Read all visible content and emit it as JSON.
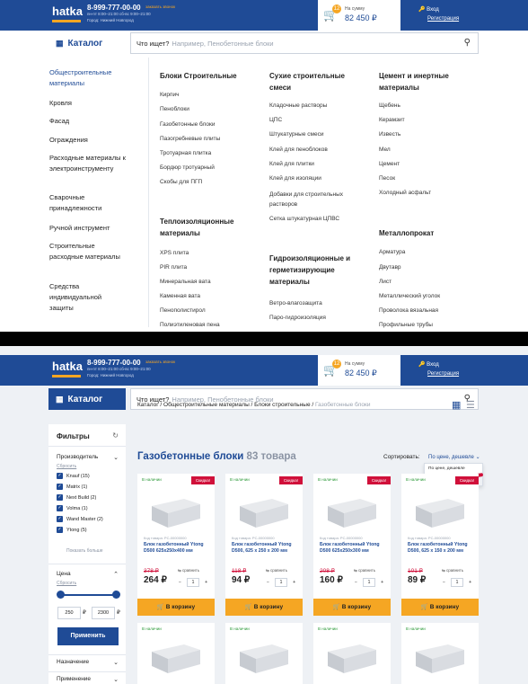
{
  "header": {
    "logo_text": "hatka",
    "phone": "8-999-777-00-00",
    "callback": "заказать звонок",
    "hours": "пн-пт 8:00–21:00  сб-вс 9:00–21:00",
    "city": "Город: Нижний Новгород",
    "cart_badge": "12",
    "cart_label": "На сумму",
    "cart_sum": "82 450 ₽",
    "login": "Вход",
    "register": "Регистрация"
  },
  "search": {
    "catalog_label": "Каталог",
    "prompt": "Что ищет?",
    "placeholder": "Например, Пенобетонные блоки"
  },
  "menu": {
    "left": [
      "Общестроительные материалы",
      "Кровля",
      "Фасад",
      "Ограждения",
      "Расходные материалы к электроинструменту",
      "Сварочные принадлежности",
      "Ручной инструмент",
      "Строительные расходные материалы",
      "Средства индивидуальной защиты"
    ],
    "columns": [
      {
        "groups": [
          {
            "title": "Блоки Строительные",
            "items": [
              "Кирпич",
              "Пеноблоки",
              "Газобетонные блоки",
              "Пазогребневые плиты",
              "Тротуарная плитка",
              "Бордюр тротуарный",
              "Скобы для ПГП"
            ]
          },
          {
            "title": "Теплоизоляционные материалы",
            "items": [
              "XPS плита",
              "PIR плита",
              "Минеральная вата",
              "Каменная вата",
              "Пенополистирол",
              "Полиэтиленовая пена"
            ]
          }
        ]
      },
      {
        "groups": [
          {
            "title": "Сухие строительные смеси",
            "items": [
              "Кладочные растворы",
              "ЦПС",
              "Штукатурные смеси",
              "Клей для пеноблоков",
              "Клей для плитки",
              "Клей для изоляции",
              "Добавки для строительных растворов",
              "Сетка штукатурная ЦПВС"
            ]
          },
          {
            "title": "Гидроизоляционные и герметизирующие материалы",
            "items": [
              "Ветро-влагозащита",
              "Паро-гидроизоляция"
            ]
          }
        ]
      },
      {
        "groups": [
          {
            "title": "Цемент и инертные материалы",
            "items": [
              "Щебень",
              "Керамзит",
              "Известь",
              "Мел",
              "Цемент",
              "Песок",
              "Холодный асфальт"
            ]
          },
          {
            "title": "Металлопрокат",
            "items": [
              "Арматура",
              "Двутавр",
              "Лист",
              "Металлический уголок",
              "Проволока вязальная",
              "Профильные трубы"
            ]
          }
        ]
      }
    ]
  },
  "filters": {
    "title": "Фильтры",
    "maker_title": "Производитель",
    "reset": "Сбросить",
    "makers": [
      "Knauf (15)",
      "Matrix (1)",
      "Next Build (2)",
      "Volma (1)",
      "Wand Master (2)",
      "Ytong (5)"
    ],
    "show_all": "Показать больше",
    "price_title": "Цена",
    "price_from": "250",
    "price_to": "2300",
    "currency": "₽",
    "apply": "Применить",
    "purpose": "Назначение",
    "application": "Применение"
  },
  "breadcrumb": {
    "path": "Каталог / Общестроительные материалы / Блоки строительные / ",
    "current": "Газобетонные блоки"
  },
  "page": {
    "title": "Газобетонные блоки",
    "count": "83 товара",
    "sort_label": "Сортировать:",
    "sort_value": "По цене, дешевле",
    "sort_options": [
      "По цене, дешевле",
      "По цене, дороже"
    ]
  },
  "products": [
    {
      "stock": "В наличии",
      "sale": "Скидка!",
      "code": "Код товара: PC-00000000",
      "name": "Блок газобетонный Ytong D500 625х250х400 мм",
      "old": "378 ₽",
      "price": "264 ₽",
      "qty": "1"
    },
    {
      "stock": "В наличии",
      "sale": "Скидка!",
      "code": "Код товара: PC-00000000",
      "name": "Блок газобетонный Ytong D500, 625 х 250 х 200 мм",
      "old": "118 ₽",
      "price": "94 ₽",
      "qty": "1"
    },
    {
      "stock": "В наличии",
      "sale": "Скидка!",
      "code": "Код товара: PC-00000000",
      "name": "Блок газобетонный Ytong D500 625х250х300 мм",
      "old": "208 ₽",
      "price": "160 ₽",
      "qty": "1"
    },
    {
      "stock": "В наличии",
      "sale": "Скидка!",
      "code": "Код товара: PC-00000000",
      "name": "Блок газобетонный Ytong D500, 625 х 150 х 200 мм",
      "old": "101 ₽",
      "price": "89 ₽",
      "qty": "1"
    }
  ],
  "card_labels": {
    "compare": "сравнить",
    "buy": "В корзину",
    "stock": "В наличии"
  },
  "colors": {
    "brand": "#1f4b96",
    "accent": "#f5a623",
    "sale": "#d0103a",
    "stock": "#2e9a3a"
  }
}
